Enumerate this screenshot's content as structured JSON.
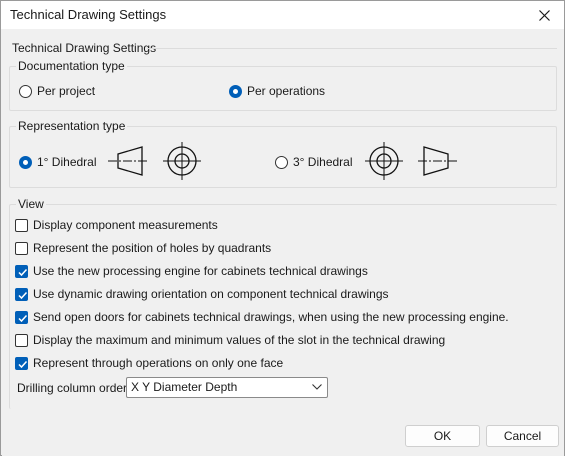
{
  "window": {
    "title": "Technical Drawing Settings"
  },
  "outer_group_label": "Technical Drawing Settings",
  "documentation": {
    "label": "Documentation type",
    "options": [
      "Per project",
      "Per operations"
    ],
    "selected": "Per operations"
  },
  "representation": {
    "label": "Representation type",
    "options": [
      "1° Dihedral",
      "3° Dihedral"
    ],
    "selected": "1° Dihedral"
  },
  "view": {
    "label": "View",
    "checkboxes": [
      {
        "label": "Display component measurements",
        "checked": false
      },
      {
        "label": "Represent the position of holes by quadrants",
        "checked": false
      },
      {
        "label": "Use the new processing engine for cabinets technical drawings",
        "checked": true
      },
      {
        "label": "Use dynamic drawing orientation on component technical drawings",
        "checked": true
      },
      {
        "label": "Send open doors for cabinets technical drawings, when using the new processing engine.",
        "checked": true
      },
      {
        "label": "Display the maximum and minimum values of the slot in the technical drawing",
        "checked": false
      },
      {
        "label": "Represent through operations on only one face",
        "checked": true
      }
    ],
    "drilling_label": "Drilling column order",
    "drilling_value": "X Y Diameter Depth"
  },
  "buttons": {
    "ok": "OK",
    "cancel": "Cancel"
  },
  "colors": {
    "accent": "#005fb8"
  }
}
